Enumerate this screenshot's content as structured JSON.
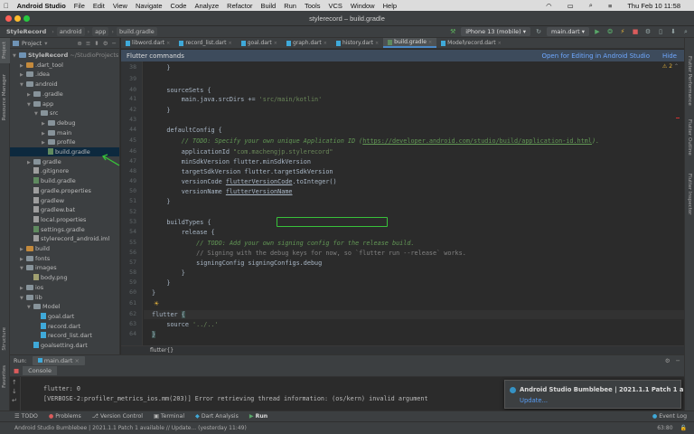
{
  "menubar": {
    "apple": "",
    "app_name": "Android Studio",
    "items": [
      "File",
      "Edit",
      "View",
      "Navigate",
      "Code",
      "Analyze",
      "Refactor",
      "Build",
      "Run",
      "Tools",
      "VCS",
      "Window",
      "Help"
    ],
    "datetime": "Thu Feb 10  11:58"
  },
  "window": {
    "title": "stylerecord – build.gradle"
  },
  "navbar": {
    "breadcrumbs": [
      "StyleRecord",
      "android",
      "app",
      "build.gradle"
    ],
    "device": "iPhone 13 (mobile)",
    "run_config": "main.dart"
  },
  "project_panel": {
    "header": "Project",
    "tree": [
      {
        "label": "StyleRecord",
        "suffix": " ~/StudioProjects",
        "type": "folder-blue",
        "indent": 0,
        "arrow": "down"
      },
      {
        "label": ".dart_tool",
        "type": "folder-orange",
        "indent": 1,
        "arrow": "right"
      },
      {
        "label": ".idea",
        "type": "folder",
        "indent": 1,
        "arrow": "right"
      },
      {
        "label": "android",
        "type": "folder",
        "indent": 1,
        "arrow": "down"
      },
      {
        "label": ".gradle",
        "type": "folder",
        "indent": 2,
        "arrow": "right"
      },
      {
        "label": "app",
        "type": "folder",
        "indent": 2,
        "arrow": "down"
      },
      {
        "label": "src",
        "type": "folder",
        "indent": 3,
        "arrow": "down"
      },
      {
        "label": "debug",
        "type": "folder",
        "indent": 4,
        "arrow": "right"
      },
      {
        "label": "main",
        "type": "folder",
        "indent": 4,
        "arrow": "right"
      },
      {
        "label": "profile",
        "type": "folder",
        "indent": 4,
        "arrow": "right"
      },
      {
        "label": "build.gradle",
        "type": "gradle",
        "indent": 4,
        "arrow": "",
        "selected": true
      },
      {
        "label": "gradle",
        "type": "folder",
        "indent": 2,
        "arrow": "right"
      },
      {
        "label": ".gitignore",
        "type": "gray",
        "indent": 2,
        "arrow": ""
      },
      {
        "label": "build.gradle",
        "type": "gradle",
        "indent": 2,
        "arrow": ""
      },
      {
        "label": "gradle.properties",
        "type": "gray",
        "indent": 2,
        "arrow": ""
      },
      {
        "label": "gradlew",
        "type": "gray",
        "indent": 2,
        "arrow": ""
      },
      {
        "label": "gradlew.bat",
        "type": "gray",
        "indent": 2,
        "arrow": ""
      },
      {
        "label": "local.properties",
        "type": "gray",
        "indent": 2,
        "arrow": ""
      },
      {
        "label": "settings.gradle",
        "type": "gradle",
        "indent": 2,
        "arrow": ""
      },
      {
        "label": "stylerecord_android.iml",
        "type": "gray",
        "indent": 2,
        "arrow": ""
      },
      {
        "label": "build",
        "type": "folder-orange",
        "indent": 1,
        "arrow": "right"
      },
      {
        "label": "fonts",
        "type": "folder",
        "indent": 1,
        "arrow": "right"
      },
      {
        "label": "images",
        "type": "folder",
        "indent": 1,
        "arrow": "down"
      },
      {
        "label": "body.png",
        "type": "img",
        "indent": 2,
        "arrow": ""
      },
      {
        "label": "ios",
        "type": "folder",
        "indent": 1,
        "arrow": "right"
      },
      {
        "label": "lib",
        "type": "folder",
        "indent": 1,
        "arrow": "down"
      },
      {
        "label": "Model",
        "type": "folder",
        "indent": 2,
        "arrow": "down"
      },
      {
        "label": "goal.dart",
        "type": "dart",
        "indent": 3,
        "arrow": ""
      },
      {
        "label": "record.dart",
        "type": "dart",
        "indent": 3,
        "arrow": ""
      },
      {
        "label": "record_list.dart",
        "type": "dart",
        "indent": 3,
        "arrow": ""
      },
      {
        "label": "goalsetting.dart",
        "type": "dart",
        "indent": 2,
        "arrow": ""
      }
    ]
  },
  "tabs": [
    {
      "label": "libword.dart",
      "active": false
    },
    {
      "label": "record_list.dart",
      "active": false
    },
    {
      "label": "goal.dart",
      "active": false
    },
    {
      "label": "graph.dart",
      "active": false
    },
    {
      "label": "history.dart",
      "active": false
    },
    {
      "label": "build.gradle",
      "active": true
    },
    {
      "label": "Model\\record.dart",
      "active": false
    }
  ],
  "banner": {
    "text": "Flutter commands",
    "open_link": "Open for Editing in Android Studio",
    "hide_link": "Hide"
  },
  "editor": {
    "warning_count": "2",
    "line_numbers": [
      "38",
      "39",
      "40",
      "41",
      "42",
      "43",
      "44",
      "45",
      "46",
      "47",
      "48",
      "49",
      "50",
      "51",
      "52",
      "53",
      "54",
      "55",
      "56",
      "57",
      "58",
      "59",
      "60",
      "61",
      "62",
      "63",
      "64"
    ],
    "highlight_text": "minSdkVersion flutter.minSdkVersion",
    "breadcrumb": "flutter{}"
  },
  "run_panel": {
    "label": "Run:",
    "tab": "main.dart",
    "console_tab": "Console",
    "lines": [
      "flutter: 0",
      "[VERBOSE-2:profiler_metrics_ios.mm(203)] Error retrieving thread information: (os/kern) invalid argument"
    ]
  },
  "notification": {
    "title": "Android Studio Bumblebee | 2021.1.1 Patch 1 a",
    "link": "Update..."
  },
  "bottom_tools": [
    "TODO",
    "Problems",
    "Version Control",
    "Terminal",
    "Dart Analysis",
    "Run"
  ],
  "bottom_right": "Event Log",
  "status": {
    "message": "Android Studio Bumblebee | 2021.1.1 Patch 1 available // Update... (yesterday 11:49)",
    "position": "63:80"
  },
  "side_labels": {
    "left": [
      "Project",
      "Resource Manager",
      "Structure",
      "Favorites"
    ],
    "right": [
      "Flutter Performance",
      "Flutter Outline",
      "Flutter Inspector"
    ]
  },
  "colors": {
    "annotation_box": "#38c23a",
    "active_tab_underline": "#4a88c7",
    "banner_bg": "#3d4b5c",
    "link": "#589df6"
  }
}
